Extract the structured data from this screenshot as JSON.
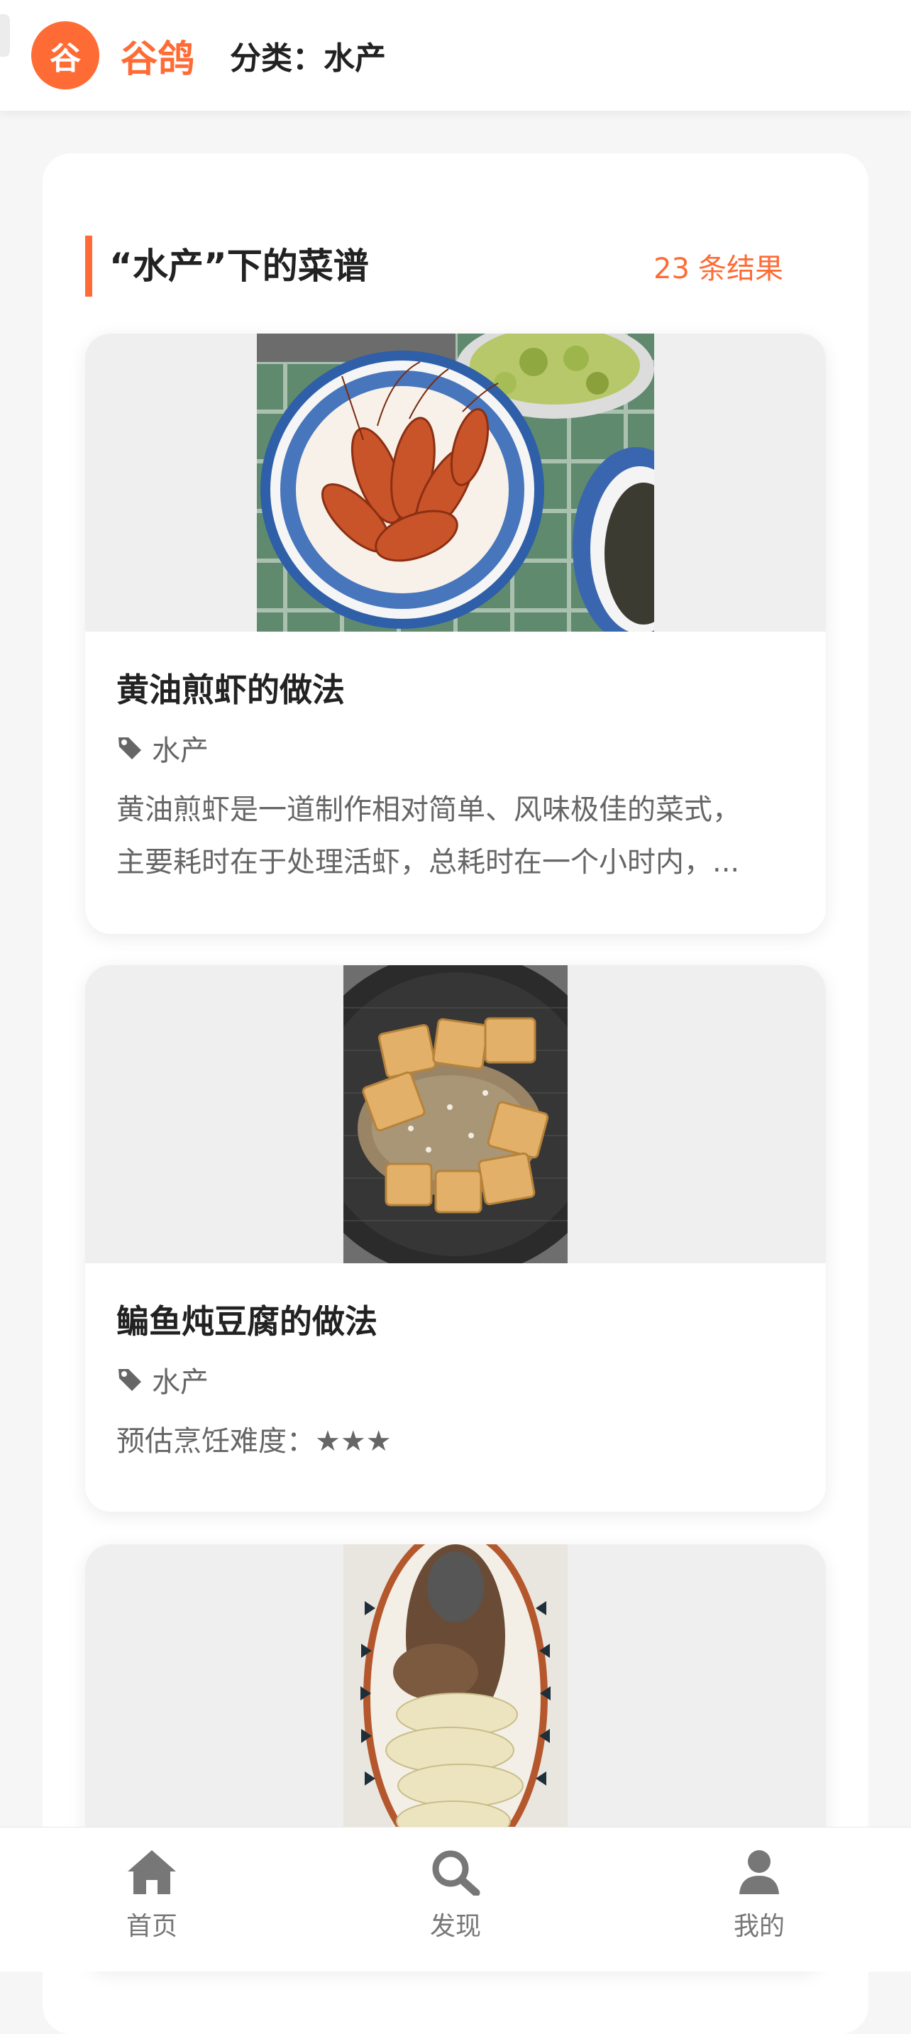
{
  "header": {
    "logo_char": "谷",
    "brand": "谷鸽",
    "category_label": "分类：水产"
  },
  "section": {
    "title": "“水产”下的菜谱",
    "count": "23",
    "count_suffix": "条结果"
  },
  "recipes": [
    {
      "title": "黄油煎虾的做法",
      "tag": "水产",
      "desc_line1": "黄油煎虾是一道制作相对简单、风味极佳的菜式，",
      "desc_line2": "主要耗时在于处理活虾，总耗时在一个小时内，..."
    },
    {
      "title": "鳊鱼炖豆腐的做法",
      "tag": "水产",
      "difficulty_label": "预估烹饪难度：",
      "difficulty_stars": "★★★"
    },
    {
      "title": "",
      "tag": ""
    }
  ],
  "icons": {
    "tag": "tag-icon",
    "home": "home-icon",
    "search": "search-icon",
    "user": "user-icon"
  },
  "colors": {
    "accent": "#ff6b35",
    "nav_icon": "#777777"
  },
  "nav": {
    "home": "首页",
    "discover": "发现",
    "mine": "我的"
  }
}
